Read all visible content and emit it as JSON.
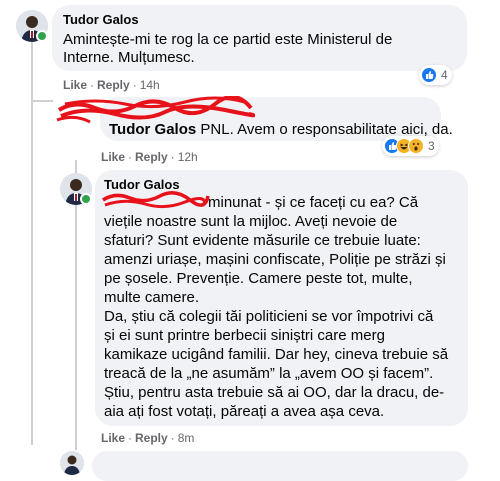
{
  "comment1": {
    "author": "Tudor Galos",
    "text_line1": "Amintește-mi te rog la ce partid este Ministerul de",
    "text_line2": "Interne. Mulțumesc.",
    "like": "Like",
    "reply": "Reply",
    "time": "14h",
    "reaction_count": "4",
    "reaction_icons": [
      "like-icon"
    ]
  },
  "comment2": {
    "author": "Tudor Galos",
    "text": " PNL. Avem o responsabilitate aici, da.",
    "like": "Like",
    "reply": "Reply",
    "time": "12h",
    "reaction_count": "3",
    "reaction_icons": [
      "like-icon",
      "haha-icon",
      "wow-icon"
    ]
  },
  "comment3": {
    "author": "Tudor Galos",
    "lines": [
      "minunat - și ce faceți cu ea? Că",
      "viețile noastre sunt la mijloc. Aveți nevoie de",
      "sfaturi? Sunt evidente măsurile ce trebuie luate:",
      "amenzi uriașe, mașini confiscate, Poliție pe străzi și",
      "pe șosele. Prevenție. Camere peste tot, multe,",
      "multe camere.",
      "Da, știu că colegii tăi politicieni se vor împotrivi că",
      "și ei sunt printre berbecii siniștri care merg",
      "kamikaze ucigând familii. Dar hey, cineva trebuie să",
      "treacă de la „ne asumăm” la „avem OO și facem”.",
      "Știu, pentru asta trebuie să ai OO, dar la dracu, de-",
      "aia ați fost votați, păreați a avea așa ceva."
    ],
    "like": "Like",
    "reply": "Reply",
    "time": "8m"
  },
  "colors": {
    "bubble": "#f0f2f5",
    "meta_text": "#65676b",
    "like_blue": "#1877f2",
    "online_green": "#31a24c",
    "redaction_red": "#e8121b"
  }
}
